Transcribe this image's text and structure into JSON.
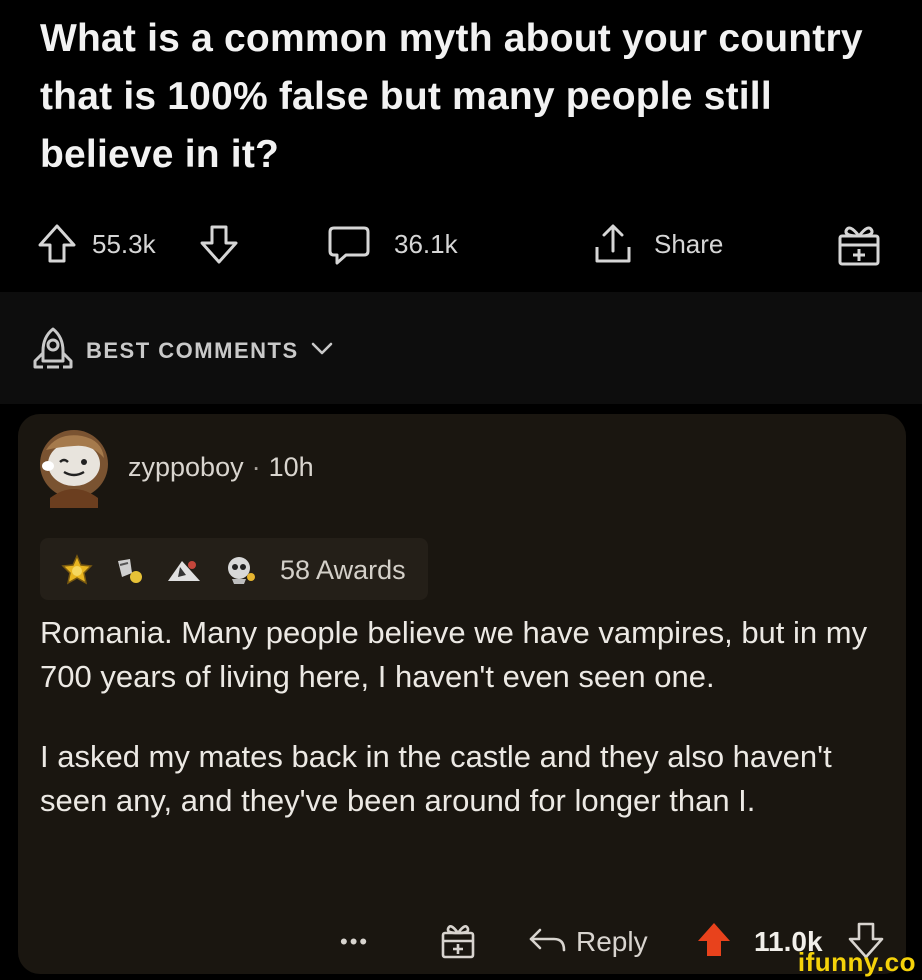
{
  "post": {
    "title": "What is a common myth about your country that is 100% false but many people still believe in it?",
    "upvotes": "55.3k",
    "comments": "36.1k",
    "share_label": "Share"
  },
  "sort": {
    "label": "BEST COMMENTS"
  },
  "comment": {
    "username": "zyppoboy",
    "separator": "·",
    "age": "10h",
    "awards_label": "58 Awards",
    "paragraphs": [
      "Romania. Many people believe we have vampires, but in my 700 years of living here, I haven't even seen one.",
      "I asked my mates back in the castle and they also haven't seen any, and they've been around for longer than I."
    ],
    "actions": {
      "more_label": "•••",
      "reply_label": "Reply",
      "score": "11.0k"
    }
  },
  "watermark": "ifunny.co",
  "colors": {
    "background": "#000000",
    "card": "#1a1610",
    "upvote_active": "#e8421c",
    "watermark": "#f5d20a"
  },
  "icons": [
    "upvote-icon",
    "downvote-icon",
    "comment-bubble-icon",
    "share-icon",
    "award-icon",
    "rocket-icon",
    "chevron-down-icon",
    "avatar",
    "more-icon",
    "reply-icon"
  ]
}
